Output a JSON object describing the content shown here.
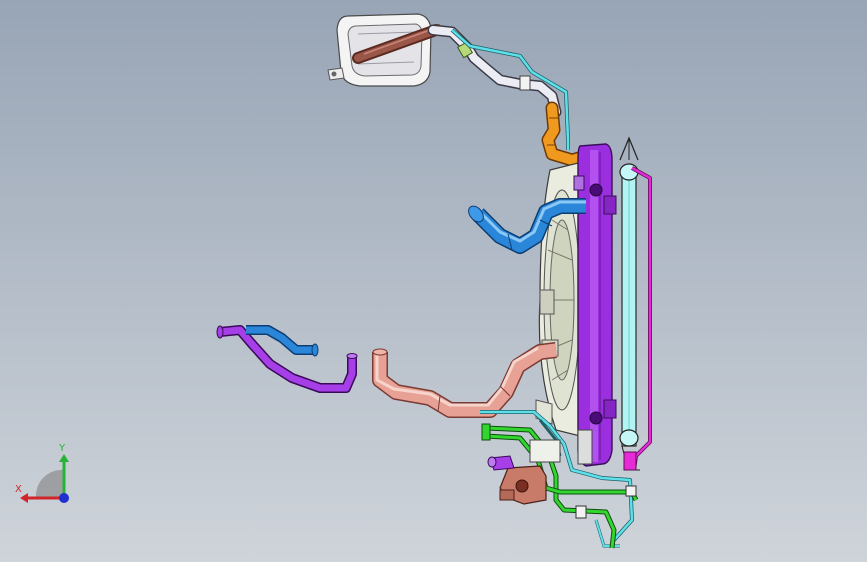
{
  "viewport": {
    "background_top": "#98a5b6",
    "background_bottom": "#cfd4da"
  },
  "triad": {
    "x_label": "X",
    "y_label": "Y",
    "x_color": "#d0262a",
    "y_color": "#27b335",
    "z_color": "#1f2fd0"
  },
  "model": {
    "parts": [
      "expansion-tank",
      "overflow-hose",
      "vent-line",
      "upper-coolant-hose",
      "radiator",
      "condenser",
      "cooling-fan",
      "heater-hose",
      "lower-coolant-hose",
      "bypass-hose",
      "transmission-oil-cooler-line",
      "bracket"
    ],
    "colors": {
      "radiator": "#9b2fe0",
      "condenser": "#b0f4f4",
      "upper_hose": "#2a86d8",
      "lower_hose": "#e7a295",
      "heater_hose": "#a63fe8",
      "vent_line": "#5ee0ea",
      "orange_fitting": "#f0991f",
      "green_line": "#32d62f",
      "magenta_line": "#e52ad6",
      "tank_tube": "#8a4a3a",
      "bracket": "#c97b6a"
    }
  }
}
